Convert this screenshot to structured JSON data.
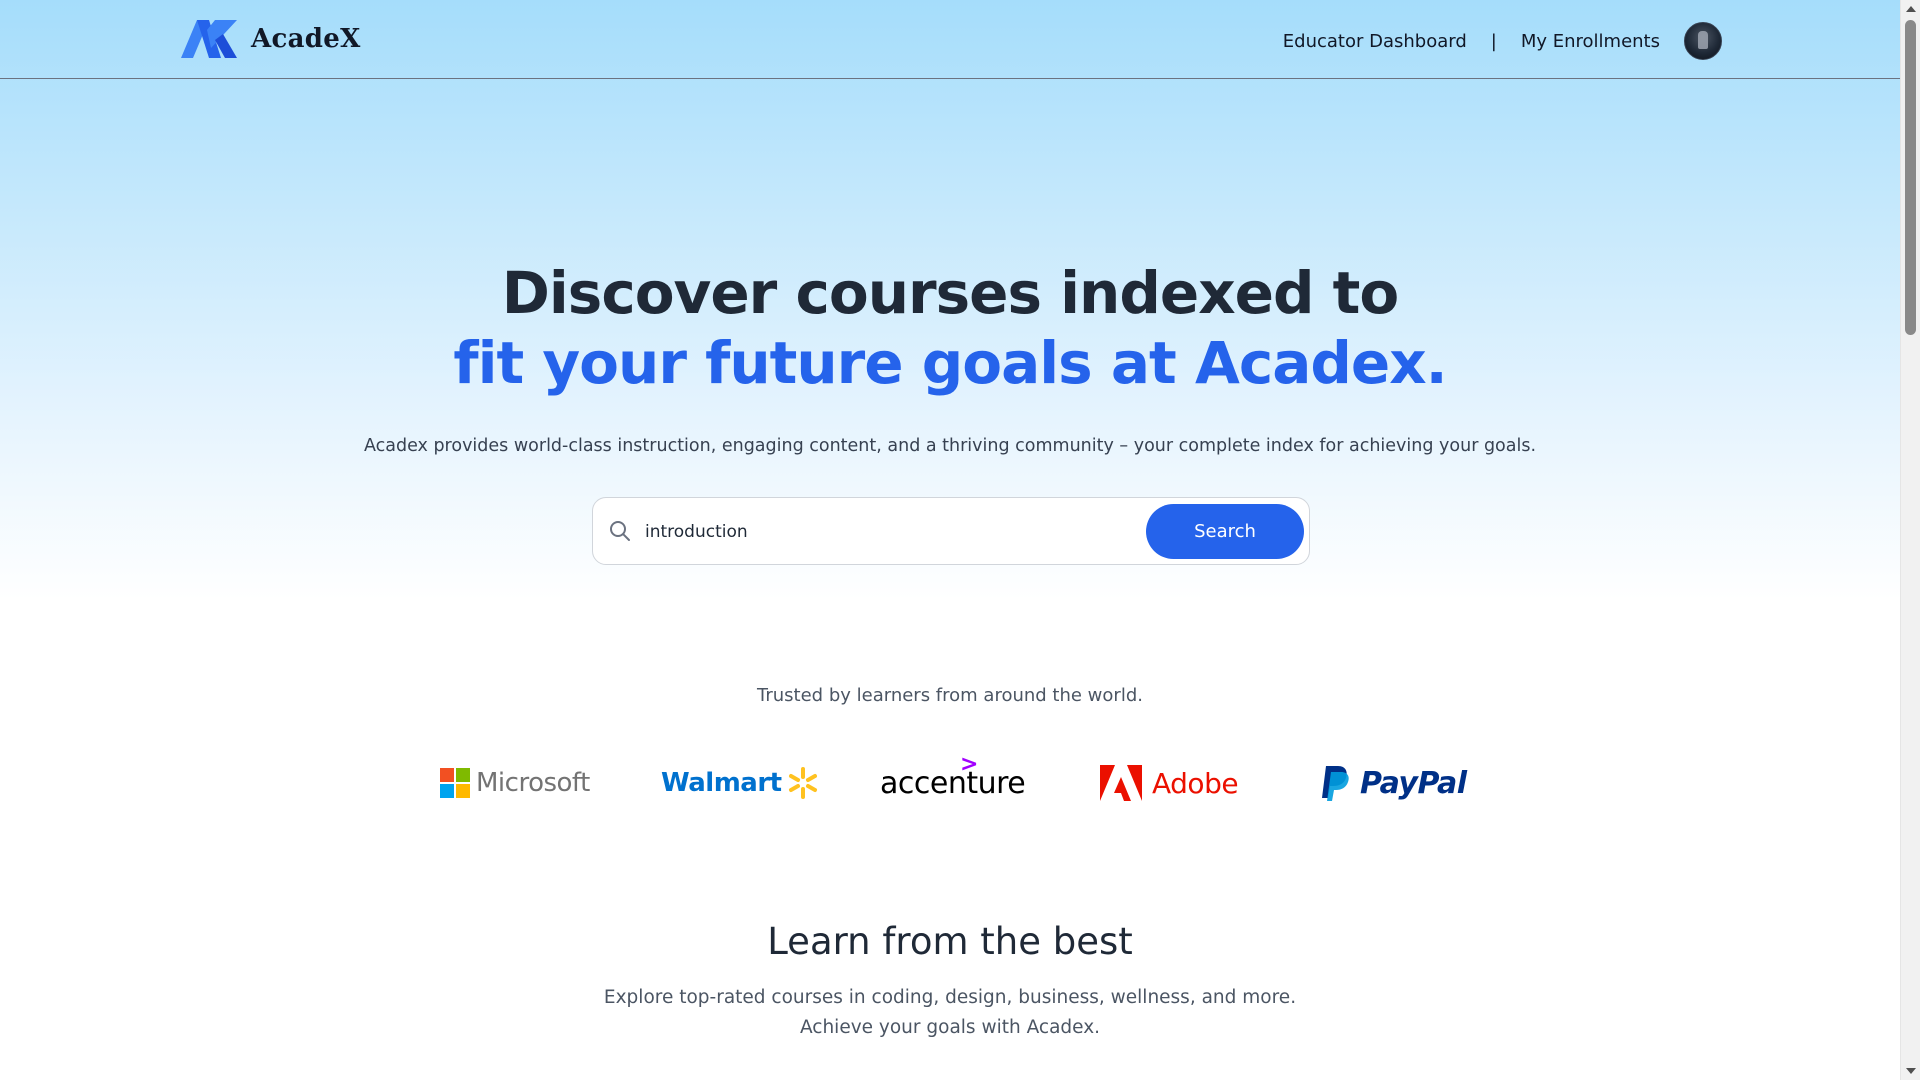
{
  "colors": {
    "accent": "#2563eb",
    "heading": "#1f2937",
    "hero_gradient_top": "#a5ddfb"
  },
  "nav": {
    "brand": "AcadeX",
    "logo_icon": "acadex-logo-icon",
    "links": [
      {
        "label": "Educator Dashboard"
      },
      {
        "label": "My Enrollments"
      }
    ],
    "separator": "|",
    "avatar_icon": "user-avatar"
  },
  "hero": {
    "title_line1": "Discover courses indexed to",
    "title_line2": "fit your future goals at Acadex.",
    "subtitle": "Acadex provides world-class instruction, engaging content, and a thriving community – your complete index for achieving your goals."
  },
  "search": {
    "icon": "search-icon",
    "value": "introduction",
    "button_label": "Search"
  },
  "trusted": {
    "text": "Trusted by learners from around the world.",
    "companies": [
      "Microsoft",
      "Walmart",
      "accenture",
      "Adobe",
      "PayPal"
    ]
  },
  "learn": {
    "title": "Learn from the best",
    "subtitle_line1": "Explore top-rated courses in coding, design, business, wellness, and more.",
    "subtitle_line2": "Achieve your goals with Acadex."
  }
}
